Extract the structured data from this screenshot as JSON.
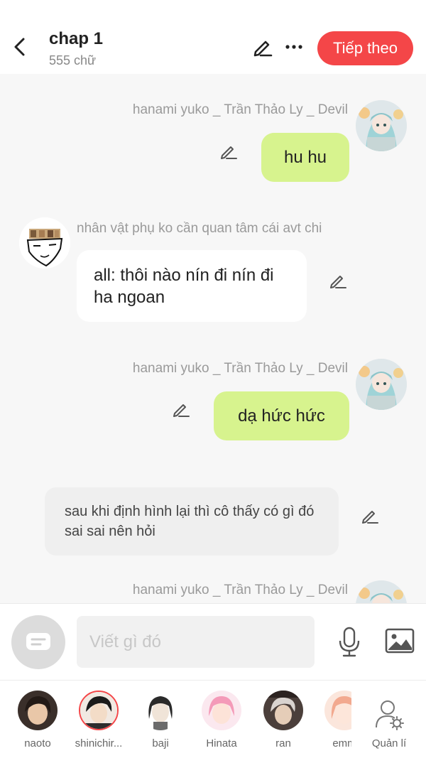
{
  "header": {
    "title": "chap 1",
    "word_count": "555 chữ",
    "next_label": "Tiếp theo"
  },
  "messages": [
    {
      "type": "green",
      "speaker": "hanami yuko _ Trần Thảo Ly _ Devil",
      "text": "hu hu"
    },
    {
      "type": "white",
      "speaker": "nhân vật phụ ko cần quan tâm cái avt chi",
      "text": "all: thôi nào nín đi nín đi ha ngoan"
    },
    {
      "type": "green",
      "speaker": "hanami yuko _ Trần Thảo Ly _ Devil",
      "text": "dạ hức hức"
    },
    {
      "type": "narration",
      "text": "sau khi định hình lại thì cô thấy có gì đó sai sai nên hỏi"
    },
    {
      "type": "green",
      "speaker": "hanami yuko _ Trần Thảo Ly _ Devil",
      "text": ""
    }
  ],
  "input": {
    "placeholder": "Viết gì đó"
  },
  "characters": [
    {
      "name": "naoto"
    },
    {
      "name": "shinichir..."
    },
    {
      "name": "baji"
    },
    {
      "name": "Hinata"
    },
    {
      "name": "ran"
    },
    {
      "name": "emm"
    }
  ],
  "manage_label": "Quản lí",
  "colors": {
    "accent": "#f44648",
    "my_bubble": "#d7f38e",
    "other_bubble": "#ffffff",
    "narration": "#efefef"
  }
}
